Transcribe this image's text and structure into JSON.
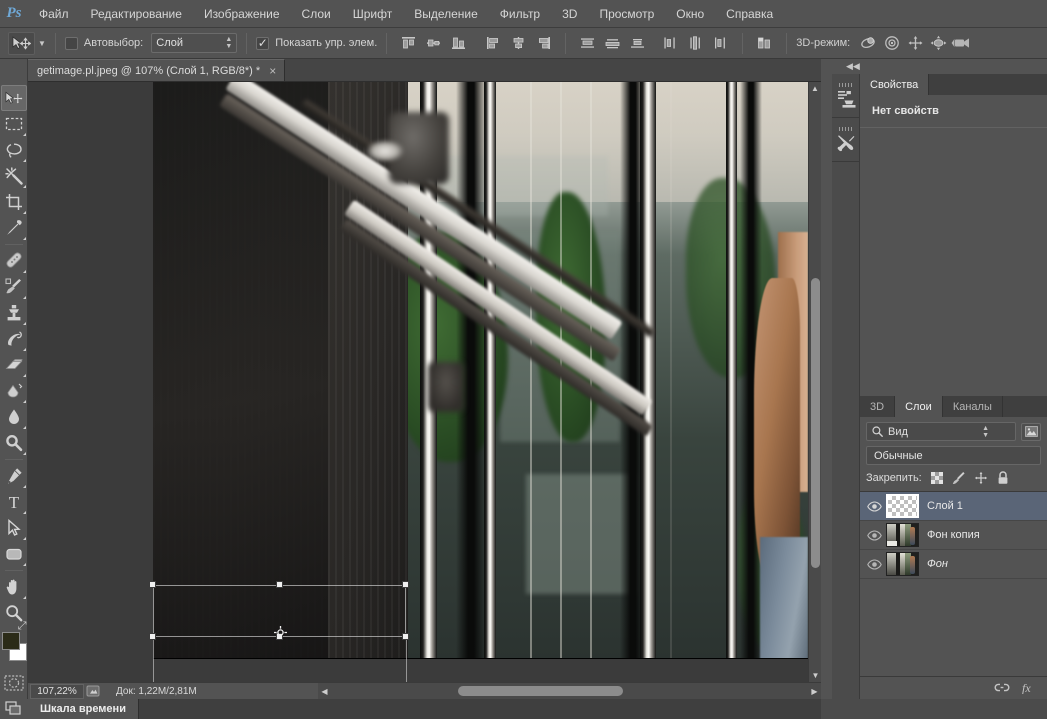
{
  "app": {
    "logo": "Ps",
    "title": "Adobe Photoshop"
  },
  "menubar": {
    "items": [
      {
        "label": "Файл",
        "name": "menu-file"
      },
      {
        "label": "Редактирование",
        "name": "menu-edit"
      },
      {
        "label": "Изображение",
        "name": "menu-image"
      },
      {
        "label": "Слои",
        "name": "menu-layers"
      },
      {
        "label": "Шрифт",
        "name": "menu-type"
      },
      {
        "label": "Выделение",
        "name": "menu-select"
      },
      {
        "label": "Фильтр",
        "name": "menu-filter"
      },
      {
        "label": "3D",
        "name": "menu-3d"
      },
      {
        "label": "Просмотр",
        "name": "menu-view"
      },
      {
        "label": "Окно",
        "name": "menu-window"
      },
      {
        "label": "Справка",
        "name": "menu-help"
      }
    ]
  },
  "options_bar": {
    "tool": "move-tool",
    "autoselect_label": "Автовыбор:",
    "autoselect_checked": false,
    "autoselect_value": "Слой",
    "show_controls_label": "Показать упр. элем.",
    "show_controls_checked": true,
    "align_icons": [
      "align-top-edges-icon",
      "align-vertical-centers-icon",
      "align-bottom-edges-icon",
      "align-left-edges-icon",
      "align-horizontal-centers-icon",
      "align-right-edges-icon",
      "distribute-top-edges-icon",
      "distribute-vertical-centers-icon",
      "distribute-bottom-edges-icon",
      "distribute-left-edges-icon",
      "distribute-horizontal-centers-icon",
      "distribute-right-edges-icon",
      "auto-align-layers-icon"
    ],
    "mode3d_label": "3D-режим:",
    "mode3d_icons": [
      "orbit-3d-icon",
      "roll-3d-icon",
      "pan-3d-icon",
      "slide-3d-icon",
      "scale-3d-icon"
    ]
  },
  "document": {
    "tab_title": "getimage.pl.jpeg @ 107% (Слой 1, RGB/8*) *",
    "close_glyph": "×"
  },
  "toolbar": {
    "tools": [
      {
        "name": "move-tool",
        "active": true,
        "has_submenu": false
      },
      {
        "name": "rectangular-marquee-tool",
        "active": false,
        "has_submenu": true
      },
      {
        "name": "lasso-tool",
        "active": false,
        "has_submenu": true
      },
      {
        "name": "magic-wand-tool",
        "active": false,
        "has_submenu": true
      },
      {
        "name": "crop-tool",
        "active": false,
        "has_submenu": true
      },
      {
        "name": "eyedropper-tool",
        "active": false,
        "has_submenu": true
      },
      {
        "name": "spot-healing-brush-tool",
        "active": false,
        "has_submenu": true
      },
      {
        "name": "brush-tool",
        "active": false,
        "has_submenu": true
      },
      {
        "name": "clone-stamp-tool",
        "active": false,
        "has_submenu": true
      },
      {
        "name": "history-brush-tool",
        "active": false,
        "has_submenu": true
      },
      {
        "name": "eraser-tool",
        "active": false,
        "has_submenu": true
      },
      {
        "name": "gradient-tool",
        "active": false,
        "has_submenu": true
      },
      {
        "name": "blur-tool",
        "active": false,
        "has_submenu": true
      },
      {
        "name": "dodge-tool",
        "active": false,
        "has_submenu": true
      },
      {
        "name": "pen-tool",
        "active": false,
        "has_submenu": true
      },
      {
        "name": "horizontal-type-tool",
        "active": false,
        "has_submenu": true
      },
      {
        "name": "path-selection-tool",
        "active": false,
        "has_submenu": true
      },
      {
        "name": "rectangle-tool",
        "active": false,
        "has_submenu": true
      },
      {
        "name": "hand-tool",
        "active": false,
        "has_submenu": true
      },
      {
        "name": "zoom-tool",
        "active": false,
        "has_submenu": false
      }
    ],
    "foreground_color": "#2b2b18",
    "background_color": "#ffffff",
    "swap_colors_icon": "swap-colors-icon",
    "default_colors_icon": "default-colors-icon",
    "quick_mask_icon": "quick-mask-icon"
  },
  "canvas": {
    "transform": {
      "handles": 8,
      "reference_point_icon": "reference-point-icon"
    },
    "vertical_scrollbar": "canvas-vertical-scrollbar",
    "horizontal_scrollbar": "canvas-horizontal-scrollbar"
  },
  "statusbar": {
    "zoom_value": "107,22%",
    "doc_info": "Док: 1,22M/2,81M",
    "thumbnail_icon": "document-thumbnail-icon",
    "expand_arrow": "▶"
  },
  "right_dock": {
    "collapse_icon": "collapse-panels-icon",
    "rail_icons": [
      "adjustments-panel-icon",
      "tools-presets-panel-icon"
    ],
    "properties": {
      "tabs": [
        {
          "label": "Свойства",
          "active": true
        }
      ],
      "empty_text": "Нет свойств"
    },
    "layers": {
      "tabs": [
        {
          "label": "3D",
          "active": false
        },
        {
          "label": "Слои",
          "active": true
        },
        {
          "label": "Каналы",
          "active": false
        }
      ],
      "filter_label": "Вид",
      "filter_icon": "search-icon",
      "filter_image_icon": "filter-image-icon",
      "blend_mode": "Обычные",
      "lock_label": "Закрепить:",
      "lock_icons": [
        "lock-transparent-pixels-icon",
        "lock-image-pixels-icon",
        "lock-position-icon",
        "lock-all-icon"
      ],
      "items": [
        {
          "name": "Слой 1",
          "selected": true,
          "visible": true,
          "italic": false,
          "thumb": "transparent"
        },
        {
          "name": "Фон копия",
          "selected": false,
          "visible": true,
          "italic": false,
          "thumb": "photo"
        },
        {
          "name": "Фон",
          "selected": false,
          "visible": true,
          "italic": true,
          "thumb": "photo"
        }
      ],
      "footer_icons": [
        "link-layers-icon",
        "layer-style-fx-icon"
      ]
    }
  },
  "timeline": {
    "tab_label": "Шкала времени",
    "screen_mode_icon": "screen-mode-icon"
  }
}
